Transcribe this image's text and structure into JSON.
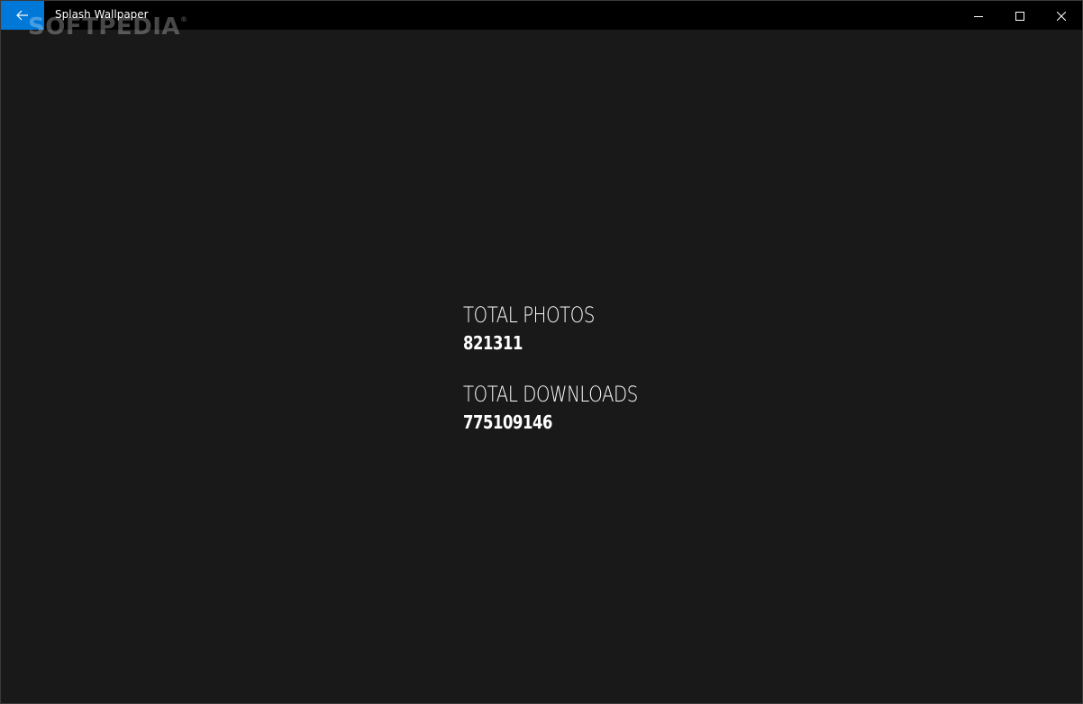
{
  "window": {
    "title": "Splash Wallpaper",
    "watermark": "SOFTPEDIA",
    "watermark_mark": "®",
    "back_icon": "arrow-left-icon",
    "accent_color": "#0078d7",
    "caption_buttons": [
      "minimize-icon",
      "maximize-icon",
      "close-icon"
    ]
  },
  "stats": [
    {
      "label": "TOTAL PHOTOS",
      "value": "821311"
    },
    {
      "label": "TOTAL DOWNLOADS",
      "value": "775109146"
    }
  ]
}
